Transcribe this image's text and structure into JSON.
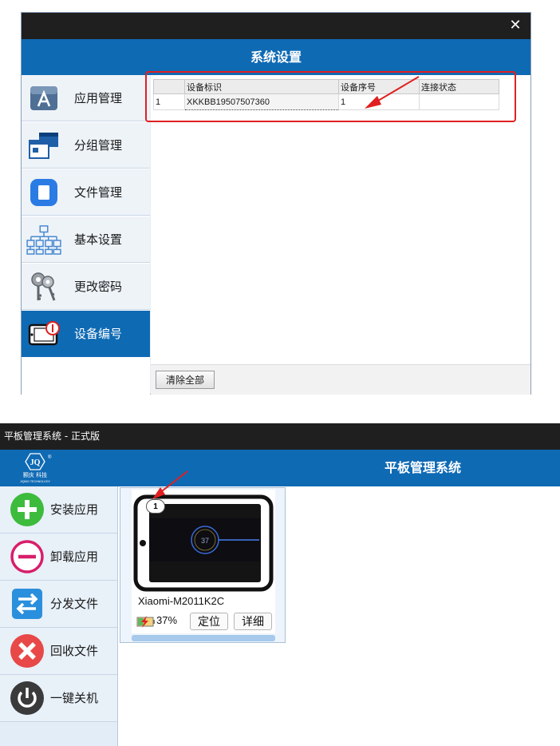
{
  "dialog": {
    "close_glyph": "✕",
    "title": "系统设置",
    "nav": [
      {
        "label": "应用管理",
        "icon": "app-store-icon"
      },
      {
        "label": "分组管理",
        "icon": "group-windows-icon"
      },
      {
        "label": "文件管理",
        "icon": "file-icon"
      },
      {
        "label": "基本设置",
        "icon": "org-tree-icon"
      },
      {
        "label": "更改密码",
        "icon": "keys-icon"
      },
      {
        "label": "设备编号",
        "icon": "tablet-number-icon",
        "active": true
      }
    ],
    "table": {
      "headers": [
        "",
        "设备标识",
        "设备序号",
        "连接状态"
      ],
      "rows": [
        [
          "1",
          "XKKBB19507507360",
          "1",
          ""
        ]
      ]
    },
    "clear_all_label": "清除全部"
  },
  "main_window": {
    "window_title": "平板管理系统 - 正式版",
    "header_title": "平板管理系统",
    "logo_text": "JQ",
    "logo_cn": "颢庆 科技",
    "logo_en": "JIQING TECHNOLOGY",
    "nav": [
      {
        "label": "安装应用",
        "icon": "plus-circle-icon"
      },
      {
        "label": "卸载应用",
        "icon": "minus-circle-icon"
      },
      {
        "label": "分发文件",
        "icon": "swap-arrows-icon"
      },
      {
        "label": "回收文件",
        "icon": "x-circle-icon"
      },
      {
        "label": "一键关机",
        "icon": "power-icon"
      }
    ],
    "device_card": {
      "badge": "1",
      "name": "Xiaomi-M2011K2C",
      "battery": "37%",
      "battery_level": 0.37,
      "locate_label": "定位",
      "detail_label": "详细",
      "screen_text": "37"
    }
  },
  "colors": {
    "accent_blue": "#0f6ab4",
    "title_bar": "#1f1f1f",
    "annotation_red": "#e02020"
  }
}
